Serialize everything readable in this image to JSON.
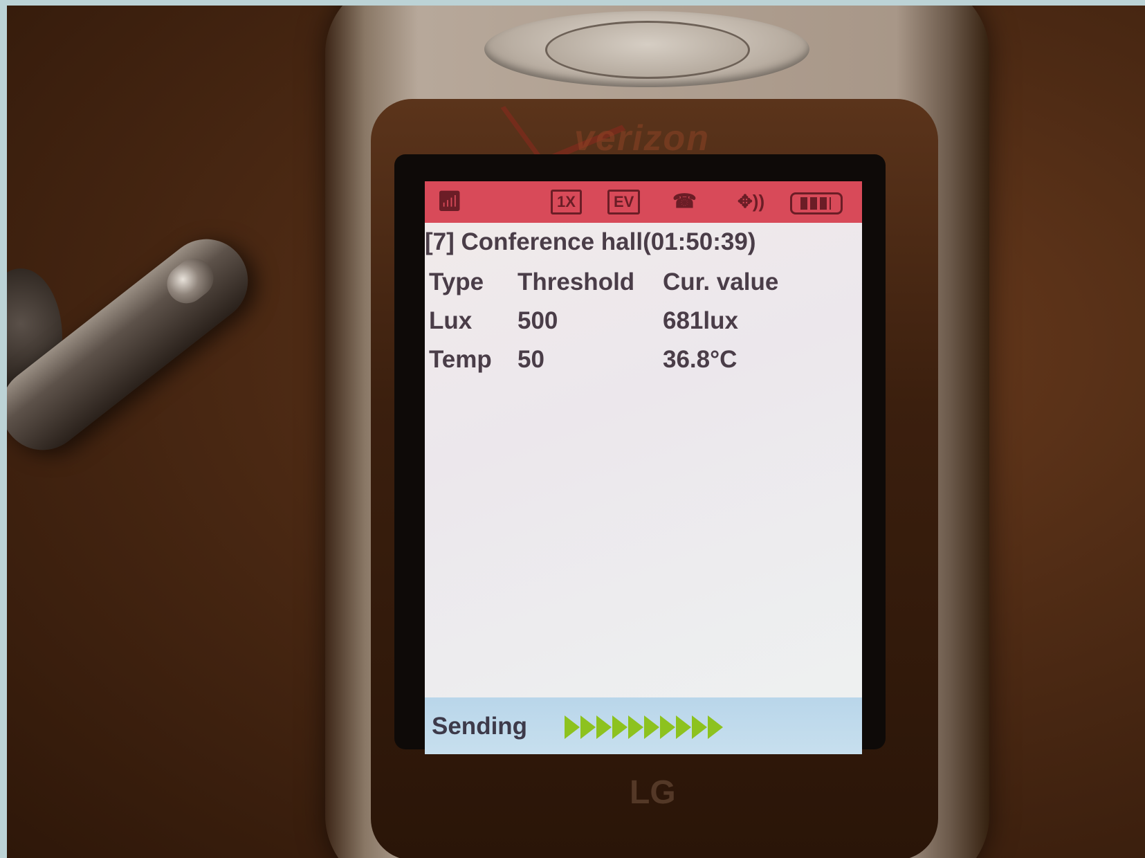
{
  "phone": {
    "carrier": "verizon",
    "maker": "LG"
  },
  "status_bar": {
    "signal_icon": "antenna-signal-icon",
    "network_1x": "1X",
    "network_ev": "EV",
    "handset_icon": "handset-icon",
    "location_icon": "location-sound-icon",
    "battery_icon": "battery-icon",
    "color": "#d84a59"
  },
  "screen": {
    "title": "[7] Conference hall(01:50:39)",
    "headers": {
      "type": "Type",
      "threshold": "Threshold",
      "current": "Cur. value"
    },
    "rows": [
      {
        "type": "Lux",
        "threshold": "500",
        "current": "681lux"
      },
      {
        "type": "Temp",
        "threshold": "50",
        "current": "36.8°C"
      }
    ],
    "footer": {
      "label": "Sending",
      "progress_arrows": 10,
      "arrow_color": "#8dc21f"
    }
  }
}
